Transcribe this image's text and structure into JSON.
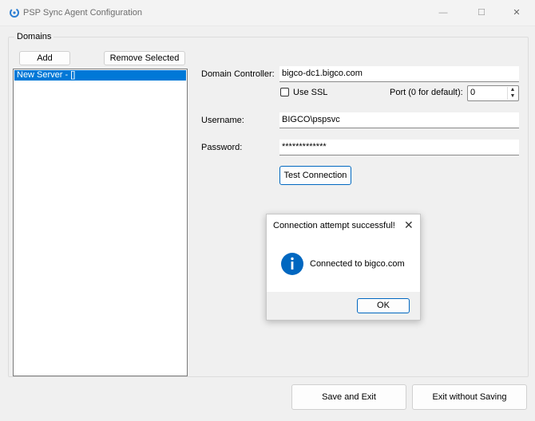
{
  "window": {
    "title": "PSP Sync Agent Configuration",
    "controls": {
      "minimize": "—",
      "maximize": "☐",
      "close": "✕"
    }
  },
  "domains": {
    "group_label": "Domains",
    "add_label": "Add",
    "remove_label": "Remove Selected",
    "servers": [
      "New Server - []"
    ]
  },
  "form": {
    "dc_label": "Domain Controller:",
    "dc_value": "bigco-dc1.bigco.com",
    "ssl_label": "Use SSL",
    "ssl_checked": false,
    "port_label": "Port (0 for default):",
    "port_value": "0",
    "username_label": "Username:",
    "username_value": "BIGCO\\pspsvc",
    "password_label": "Password:",
    "password_value": "*************",
    "test_label": "Test Connection"
  },
  "dialog": {
    "title": "Connection attempt successful!",
    "close": "✕",
    "icon": "info-icon",
    "message": "Connected to bigco.com",
    "ok_label": "OK"
  },
  "footer": {
    "save_label": "Save and Exit",
    "exit_label": "Exit without Saving"
  },
  "colors": {
    "accent": "#0078d7",
    "info_icon": "#0067c0",
    "button_focus": "#0067c0"
  }
}
